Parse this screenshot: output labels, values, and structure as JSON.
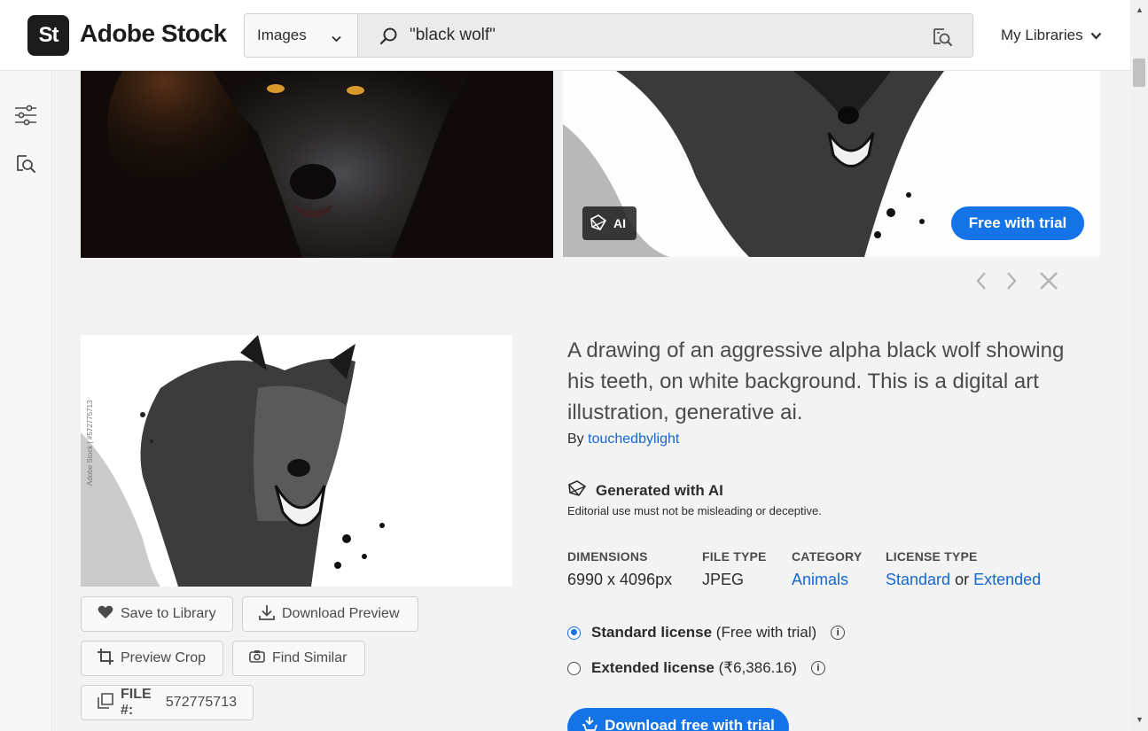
{
  "header": {
    "logo_mark": "St",
    "logo_text": "Adobe Stock",
    "search_type": "Images",
    "search_query": "\"black wolf\"",
    "my_libraries": "My Libraries"
  },
  "rail": {
    "icons": [
      "filter-icon",
      "visual-search-icon"
    ]
  },
  "gallery": {
    "ai_badge": "AI",
    "free_trial_label": "Free with trial"
  },
  "detail": {
    "image_watermark": "Adobe Stock | #572775713",
    "title": "A drawing of an aggressive alpha black wolf showing his teeth, on white background. This is a digital art illustration, generative ai.",
    "by_prefix": "By",
    "author": "touchedbylight",
    "generated_label": "Generated with AI",
    "editorial_note": "Editorial use must not be misleading or deceptive.",
    "meta": {
      "dimensions_label": "DIMENSIONS",
      "dimensions_value": "6990 x 4096px",
      "file_type_label": "FILE TYPE",
      "file_type_value": "JPEG",
      "category_label": "CATEGORY",
      "category_value": "Animals",
      "license_type_label": "LICENSE TYPE",
      "license_standard": "Standard",
      "license_or": "or",
      "license_extended": "Extended"
    },
    "licenses": {
      "standard_name": "Standard license",
      "standard_price": "(Free with trial)",
      "extended_name": "Extended license",
      "extended_price": "(₹6,386.16)"
    },
    "actions": {
      "save_to_library": "Save to Library",
      "download_preview": "Download Preview",
      "preview_crop": "Preview Crop",
      "find_similar": "Find Similar",
      "file_label": "FILE #:",
      "file_number": "572775713"
    },
    "download_button": "Download free with trial"
  },
  "colors": {
    "accent": "#1473e6",
    "link": "#1667cf",
    "text": "#2c2c2c"
  }
}
